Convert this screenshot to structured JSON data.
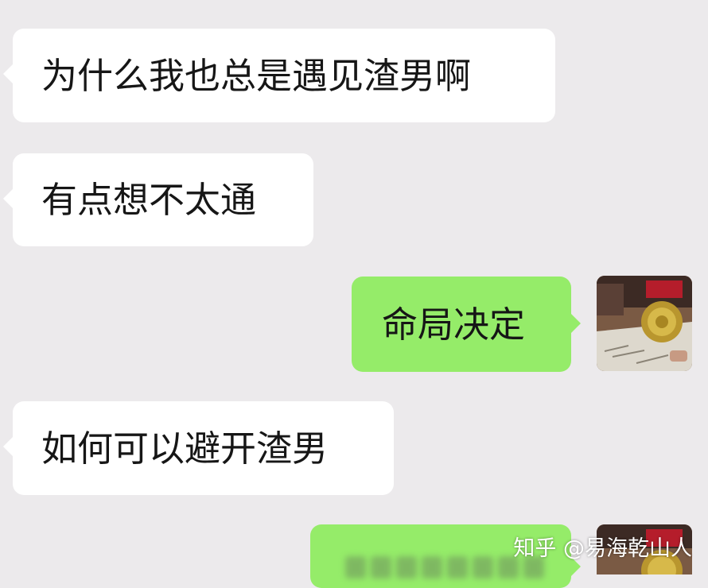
{
  "chat": {
    "messages": [
      {
        "side": "received",
        "text": "为什么我也总是遇见渣男啊"
      },
      {
        "side": "received",
        "text": "有点想不太通"
      },
      {
        "side": "sent",
        "text": "命局决定"
      },
      {
        "side": "received",
        "text": "如何可以避开渣男"
      },
      {
        "side": "sent",
        "text": ""
      }
    ]
  },
  "avatar": {
    "icon": "user-avatar-photo"
  },
  "watermark": {
    "text": "知乎 @易海乾山人"
  },
  "colors": {
    "background": "#eceaec",
    "received_bubble": "#ffffff",
    "sent_bubble": "#95ec69",
    "text": "#161616"
  }
}
